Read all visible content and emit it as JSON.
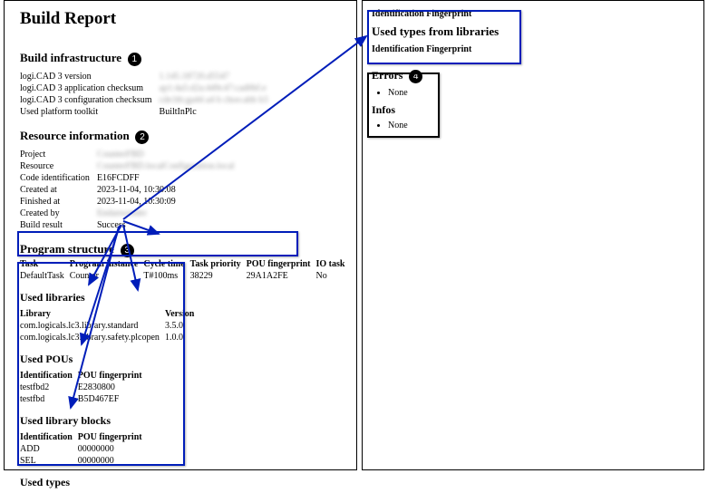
{
  "title": "Build Report",
  "sections": {
    "infra": {
      "heading": "Build infrastructure",
      "rows": [
        {
          "k": "logi.CAD 3 version",
          "v": "1.145.18720.d5547",
          "blur": true
        },
        {
          "k": "logi.CAD 3 application checksum",
          "v": "ap1:4a5:d2a:449c47:cad0bf.e",
          "blur": true
        },
        {
          "k": "logi.CAD 3 configuration checksum",
          "v": "cde:bb:ga44 a4 b choo:abb b3",
          "blur": true
        },
        {
          "k": "Used platform toolkit",
          "v": "BuiltInPlc",
          "blur": false
        }
      ]
    },
    "resource": {
      "heading": "Resource information",
      "rows": [
        {
          "k": "Project",
          "v": "CounterFBD",
          "blur": true
        },
        {
          "k": "Resource",
          "v": "CounterFBD.localConfiguration.local",
          "blur": true
        },
        {
          "k": "Code identification",
          "v": "E16FCDFF",
          "blur": false
        },
        {
          "k": "Created at",
          "v": "2023-11-04, 10:30:08",
          "blur": false
        },
        {
          "k": "Finished at",
          "v": "2023-11-04, 10:30:09",
          "blur": false
        },
        {
          "k": "Created by",
          "v": "Endanwender",
          "blur": true
        },
        {
          "k": "Build result",
          "v": "Success",
          "blur": false
        }
      ]
    },
    "program": {
      "heading": "Program structure",
      "cols": [
        "Task",
        "Program instance",
        "Cycle time",
        "Task priority",
        "POU fingerprint",
        "IO task"
      ],
      "rows": [
        [
          "DefaultTask",
          "Counter",
          "T#100ms",
          "38229",
          "29A1A2FE",
          "No"
        ]
      ]
    },
    "usedLibs": {
      "heading": "Used libraries",
      "cols": [
        "Library",
        "Version"
      ],
      "rows": [
        [
          "com.logicals.lc3.library.standard",
          "3.5.0"
        ],
        [
          "com.logicals.lc3.library.safety.plcopen",
          "1.0.0"
        ]
      ]
    },
    "usedPous": {
      "heading": "Used POUs",
      "cols": [
        "Identification",
        "POU fingerprint"
      ],
      "rows": [
        [
          "testfbd2",
          "E2830800"
        ],
        [
          "testfbd",
          "B5D467EF"
        ]
      ]
    },
    "usedLibBlocks": {
      "heading": "Used library blocks",
      "cols": [
        "Identification",
        "POU fingerprint"
      ],
      "rows": [
        [
          "ADD",
          "00000000"
        ],
        [
          "SEL",
          "00000000"
        ]
      ]
    },
    "usedTypes": {
      "heading": "Used types"
    },
    "rightHeads": {
      "identFp1": "Identification Fingerprint",
      "usedTypesLibs": "Used types from libraries",
      "identFp2": "Identification Fingerprint"
    },
    "errors": {
      "heading": "Errors",
      "items": [
        "None"
      ]
    },
    "infos": {
      "heading": "Infos",
      "items": [
        "None"
      ]
    }
  },
  "badges": {
    "b1": "1",
    "b2": "2",
    "b3": "3",
    "b4": "4"
  }
}
